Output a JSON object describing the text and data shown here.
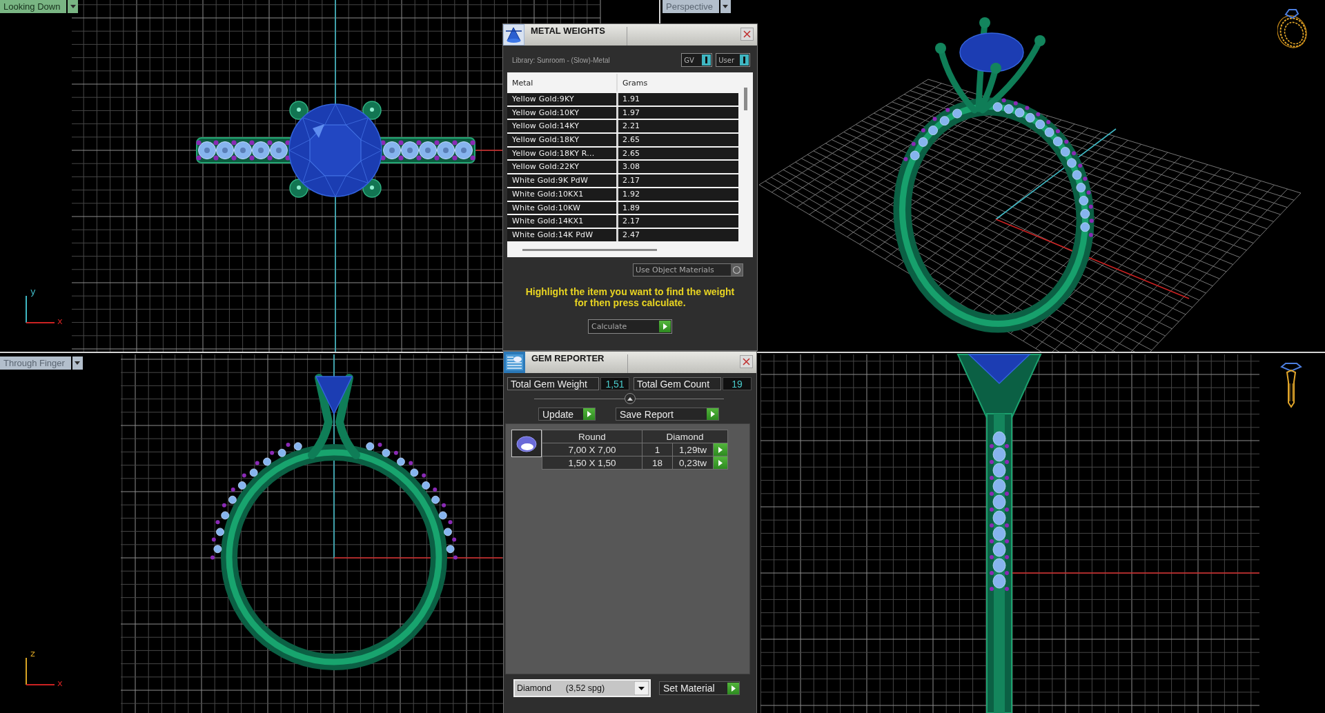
{
  "viewports": [
    {
      "kind": "top",
      "label": "Looking Down",
      "selected": true,
      "axes": {
        "vertical": "y",
        "horizontal": "x"
      }
    },
    {
      "kind": "perspective",
      "label": "Perspective",
      "selected": false
    },
    {
      "kind": "front",
      "label": "Through Finger",
      "selected": false,
      "axes": {
        "vertical": "z",
        "horizontal": "x"
      }
    },
    {
      "kind": "side"
    }
  ],
  "metal_weights": {
    "title": "METAL WEIGHTS",
    "library": "Library: Sunroom - (Slow)-Metal",
    "toggles": [
      {
        "label": "GV",
        "on": true
      },
      {
        "label": "User",
        "on": true
      }
    ],
    "table": {
      "columns": [
        "Metal",
        "Grams"
      ],
      "rows": [
        {
          "cells": [
            "Yellow Gold:9KY",
            "1.91"
          ],
          "selected": false
        },
        {
          "cells": [
            "Yellow Gold:10KY",
            "1.97"
          ],
          "selected": false
        },
        {
          "cells": [
            "Yellow Gold:14KY",
            "2.21"
          ],
          "selected": false
        },
        {
          "cells": [
            "Yellow Gold:18KY",
            "2.65"
          ],
          "selected": false
        },
        {
          "cells": [
            "Yellow Gold:18KY R...",
            "2.65"
          ],
          "selected": false
        },
        {
          "cells": [
            "Yellow Gold:22KY",
            "3.08"
          ],
          "selected": false
        },
        {
          "cells": [
            "White Gold:9K PdW",
            "2.17"
          ],
          "selected": false
        },
        {
          "cells": [
            "White Gold:10KX1",
            "1.92"
          ],
          "selected": false
        },
        {
          "cells": [
            "White Gold:10KW",
            "1.89"
          ],
          "selected": false
        },
        {
          "cells": [
            "White Gold:14KX1",
            "2.17"
          ],
          "selected": false
        },
        {
          "cells": [
            "White Gold:14K PdW",
            "2.47"
          ],
          "selected": false
        }
      ]
    },
    "use_object_materials": {
      "label": "Use Object Materials",
      "checked": false
    },
    "hint": "Highlight the item you want to find the weight for then press calculate.",
    "calculate_button": "Calculate"
  },
  "gem_reporter": {
    "title": "GEM REPORTER",
    "totals": [
      {
        "label": "Total Gem Weight",
        "value": "1,51"
      },
      {
        "label": "Total Gem Count",
        "value": "19"
      }
    ],
    "buttons": [
      "Update",
      "Save Report"
    ],
    "gem_table": {
      "header": [
        "Round",
        "Diamond"
      ],
      "rows": [
        {
          "size": "7,00 X 7,00",
          "count": "1",
          "weight": "1,29tw"
        },
        {
          "size": "1,50 X 1,50",
          "count": "18",
          "weight": "0,23tw"
        }
      ]
    },
    "material_dropdown": {
      "value": "Diamond      (3,52 spg)"
    },
    "set_material_button": "Set Material"
  }
}
